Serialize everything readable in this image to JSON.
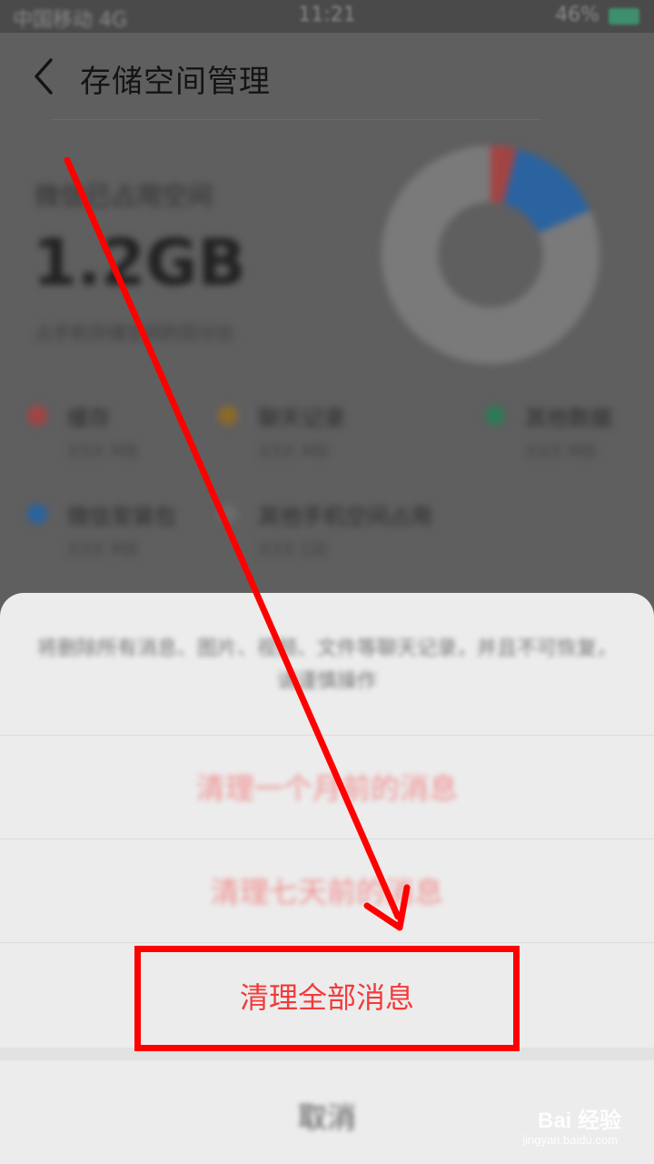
{
  "status_bar": {
    "carrier": "中国移动 4G",
    "time": "11:21",
    "battery": "46%"
  },
  "header": {
    "title": "存储空间管理"
  },
  "usage": {
    "label": "微信已占用空间",
    "value": "1.2GB",
    "sub": "占手机存储空间的百分比"
  },
  "legend": [
    {
      "name": "缓存",
      "size": "XXX MB",
      "color": "#a34444"
    },
    {
      "name": "聊天记录",
      "size": "XXX MB",
      "color": "#8a6a2a"
    },
    {
      "name": "其他数据",
      "size": "XXX MB",
      "color": "#2f7a57"
    },
    {
      "name": "微信安装包",
      "size": "XXX MB",
      "color": "#2a63a0"
    },
    {
      "name": "其他手机空间占用",
      "size": "XXX GB",
      "color": "#6a6a6a"
    }
  ],
  "sheet": {
    "description": "将删除所有消息、图片、视频、文件等聊天记录，并且不可恢复，请谨慎操作",
    "options": [
      {
        "label": "清理一个月前的消息"
      },
      {
        "label": "清理七天前的消息"
      },
      {
        "label": "清理全部消息"
      }
    ],
    "cancel": "取消"
  },
  "watermark": {
    "brand": "Bai 经验",
    "url": "jingyan.baidu.com"
  },
  "colors": {
    "accent_red": "#f33a3a",
    "annotation_red": "#ff0000"
  }
}
